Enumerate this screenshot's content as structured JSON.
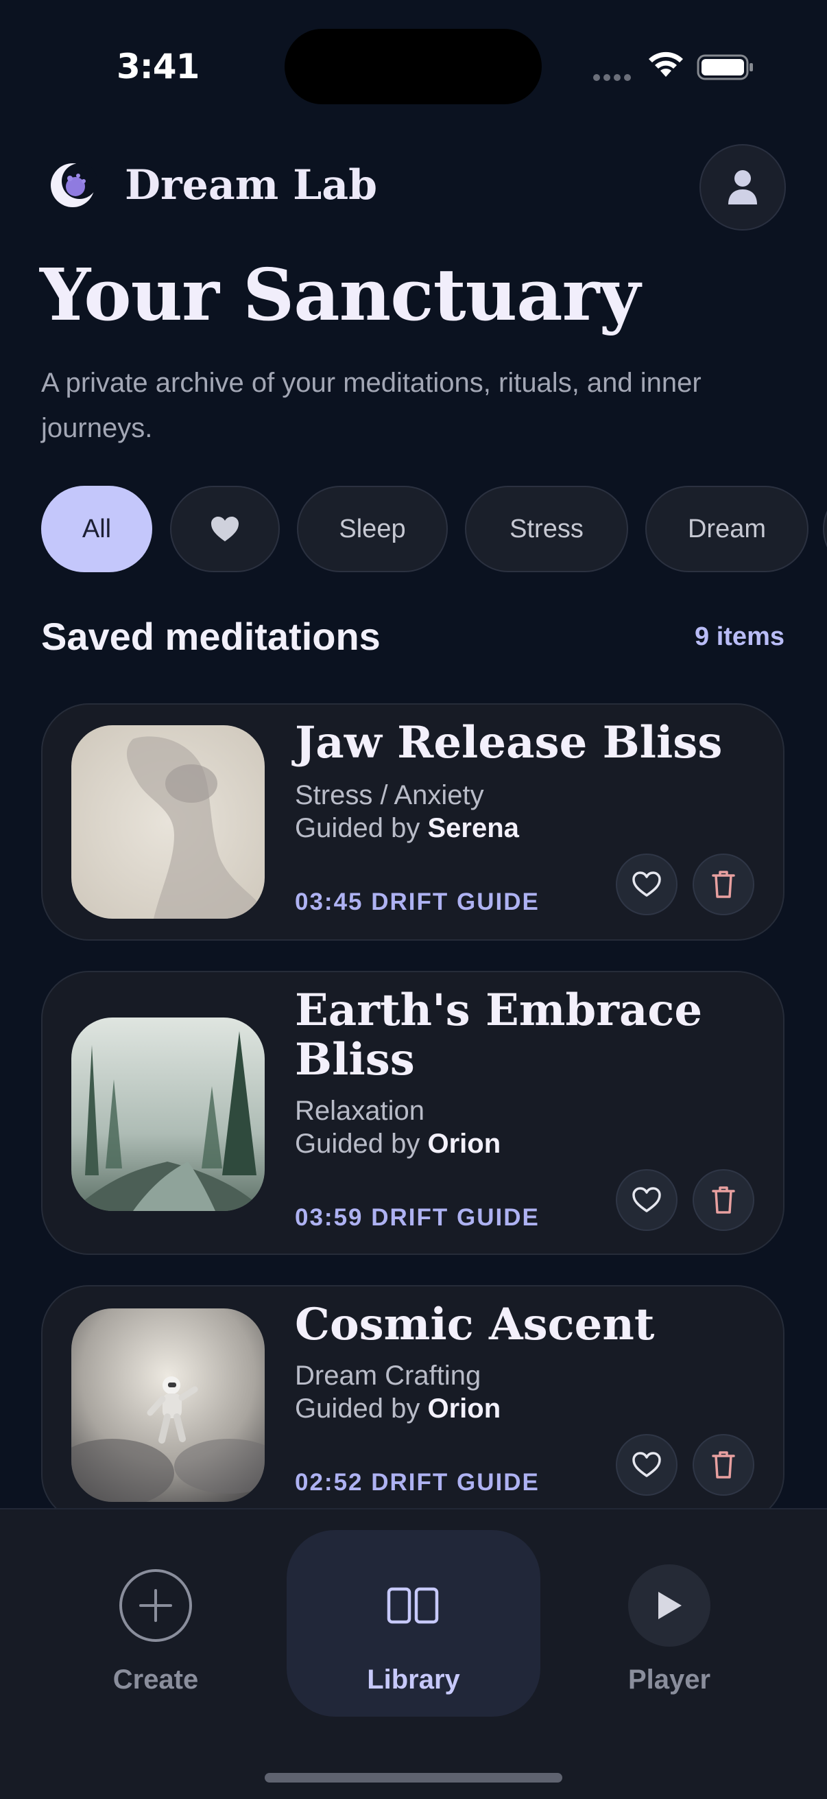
{
  "status_bar": {
    "time": "3:41"
  },
  "header": {
    "app_name": "Dream Lab"
  },
  "page": {
    "title": "Your Sanctuary",
    "subtitle": "A private archive of your meditations, rituals, and inner journeys."
  },
  "filters": [
    {
      "label": "All",
      "active": true
    },
    {
      "label": "",
      "icon": "heart-icon",
      "active": false
    },
    {
      "label": "Sleep",
      "active": false
    },
    {
      "label": "Stress",
      "active": false
    },
    {
      "label": "Dream",
      "active": false
    }
  ],
  "section": {
    "title": "Saved meditations",
    "count": "9 items"
  },
  "meditations": [
    {
      "title": "Jaw Release Bliss",
      "category": "Stress / Anxiety",
      "guided_prefix": "Guided by ",
      "guide": "Serena",
      "duration": "03:45 DRIFT GUIDE",
      "thumbnail": "woman-face-mist"
    },
    {
      "title": "Earth's Embrace Bliss",
      "category": "Relaxation",
      "guided_prefix": "Guided by ",
      "guide": "Orion",
      "duration": "03:59 DRIFT GUIDE",
      "thumbnail": "misty-forest"
    },
    {
      "title": "Cosmic Ascent",
      "category": "Dream Crafting",
      "guided_prefix": "Guided by ",
      "guide": "Orion",
      "duration": "02:52 DRIFT GUIDE",
      "thumbnail": "astronaut-clouds"
    }
  ],
  "nav": {
    "create": "Create",
    "library": "Library",
    "player": "Player",
    "active": "Library"
  },
  "colors": {
    "background": "#0b1220",
    "accent": "#c4c7fb",
    "card": "#171b25",
    "delete": "#e8a0a0"
  }
}
